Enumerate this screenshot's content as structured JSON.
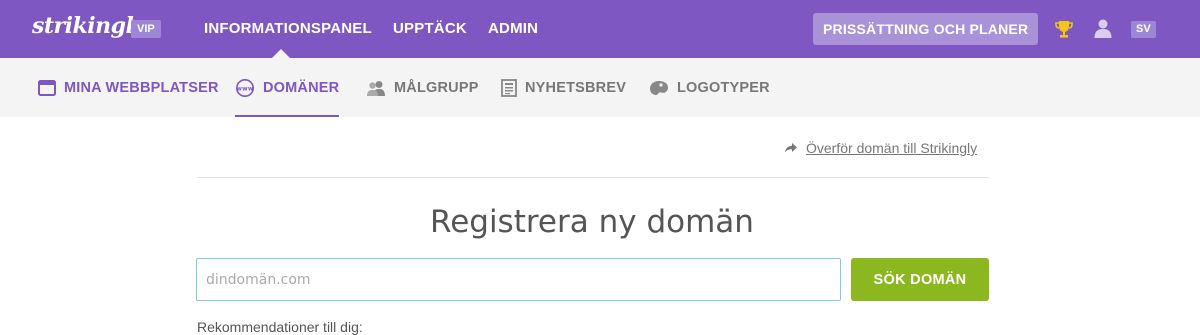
{
  "topbar": {
    "logo": "strikingly",
    "badge": "VIP",
    "nav": [
      "INFORMATIONSPANEL",
      "UPPTÄCK",
      "ADMIN"
    ],
    "pricing_label": "PRISSÄTTNING OCH PLANER",
    "language": "SV",
    "icons": [
      "trophy-icon",
      "user-icon"
    ],
    "colors": {
      "bar": "#7e57c2",
      "pricing": "#a992d8",
      "trophy": "#f5c518"
    }
  },
  "subnav": {
    "items": [
      {
        "label": "MINA WEBBPLATSER",
        "icon": "window-icon",
        "active": false
      },
      {
        "label": "DOMÄNER",
        "icon": "www-icon",
        "active": true
      },
      {
        "label": "MÅLGRUPP",
        "icon": "people-icon",
        "active": false
      },
      {
        "label": "NYHETSBREV",
        "icon": "newsletter-icon",
        "active": false
      },
      {
        "label": "LOGOTYPER",
        "icon": "palette-icon",
        "active": false
      }
    ],
    "colors": {
      "accent": "#7e57c2",
      "inactive": "#777777"
    }
  },
  "content": {
    "transfer_link": "Överför domän till Strikingly",
    "heading": "Registrera ny domän",
    "search": {
      "placeholder": "dindomän.com",
      "value": ""
    },
    "search_button": "SÖK DOMÄN",
    "recommendations": "Rekommendationer till dig:",
    "colors": {
      "button": "#8cb81f",
      "input_border": "#7ccbe8"
    }
  }
}
